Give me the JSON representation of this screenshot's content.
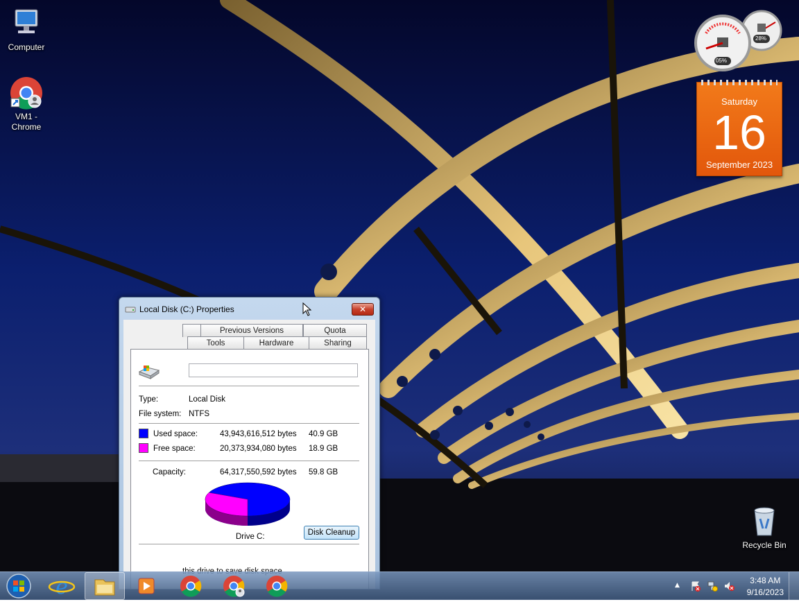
{
  "desktop": {
    "icons": [
      {
        "label": "Computer"
      },
      {
        "label": "VM1 -\nChrome"
      },
      {
        "label": "Recycle Bin"
      }
    ]
  },
  "gadgets": {
    "cpu_meter": {
      "cpu_percent": "05%",
      "memory_percent": "28%"
    },
    "calendar": {
      "weekday": "Saturday",
      "day": "16",
      "month_year": "September 2023"
    }
  },
  "window": {
    "title": "Local Disk (C:) Properties",
    "close_label": "✕",
    "tabs_row1": [
      "Previous Versions",
      "Quota"
    ],
    "tabs_row2": [
      "Tools",
      "Hardware",
      "Sharing"
    ],
    "volume_name_value": "",
    "type_label": "Type:",
    "type_value": "Local Disk",
    "fs_label": "File system:",
    "fs_value": "NTFS",
    "used_label": "Used space:",
    "used_bytes": "43,943,616,512 bytes",
    "used_gb": "40.9 GB",
    "free_label": "Free space:",
    "free_bytes": "20,373,934,080 bytes",
    "free_gb": "18.9 GB",
    "capacity_label": "Capacity:",
    "capacity_bytes": "64,317,550,592 bytes",
    "capacity_gb": "59.8 GB",
    "drive_label": "Drive C:",
    "cleanup_button": "Disk Cleanup",
    "bottom_text": "this drive to save disk space",
    "used_color": "#0000ff",
    "free_color": "#ff00ff",
    "used_fraction": 0.683
  },
  "taskbar": {
    "time": "3:48 AM",
    "date": "9/16/2023",
    "tray_arrow": "▲"
  }
}
